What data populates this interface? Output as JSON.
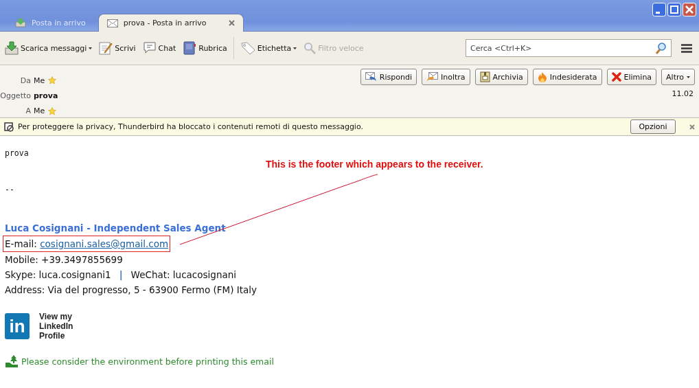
{
  "window": {
    "tabs": [
      {
        "label": "Posta in arrivo",
        "kind": "inbox",
        "selected": false,
        "closable": false
      },
      {
        "label": "prova - Posta in arrivo",
        "kind": "envelope",
        "selected": true,
        "closable": true
      }
    ]
  },
  "toolbar": {
    "groups": [
      [
        {
          "label": "Scarica messaggi",
          "kind": "download",
          "dropdown": true,
          "disabled": false
        },
        {
          "label": "Scrivi",
          "kind": "write",
          "dropdown": false,
          "disabled": false
        },
        {
          "label": "Chat",
          "kind": "chat",
          "dropdown": false,
          "disabled": false
        },
        {
          "label": "Rubrica",
          "kind": "book",
          "dropdown": false,
          "disabled": false
        }
      ],
      [
        {
          "label": "Etichetta",
          "kind": "tag",
          "dropdown": true,
          "disabled": false
        },
        {
          "label": "Filtro veloce",
          "kind": "magnifier",
          "dropdown": false,
          "disabled": true
        }
      ]
    ],
    "search": {
      "placeholder": "Cerca <Ctrl+K>"
    }
  },
  "header": {
    "fields": [
      {
        "label": "Da",
        "value": "Me",
        "kind": "contact",
        "starred": true
      },
      {
        "label": "Oggetto",
        "value": "prova",
        "kind": "subject"
      },
      {
        "label": "A",
        "value": "Me",
        "kind": "contact",
        "starred": true
      }
    ],
    "actions": [
      {
        "label": "Rispondi",
        "kind": "reply",
        "dropdown": false
      },
      {
        "label": "Inoltra",
        "kind": "forward",
        "dropdown": false
      },
      {
        "label": "Archivia",
        "kind": "archive",
        "dropdown": false
      },
      {
        "label": "Indesiderata",
        "kind": "flame",
        "dropdown": false
      },
      {
        "label": "Elimina",
        "kind": "delete",
        "dropdown": false
      },
      {
        "label": "Altro",
        "kind": "menu",
        "dropdown": true
      }
    ],
    "time": "11.02"
  },
  "notification": {
    "text": "Per proteggere la privacy, Thunderbird ha bloccato i contenuti remoti di questo messaggio.",
    "button": "Opzioni"
  },
  "body": {
    "greeting": "prova",
    "separator": "--",
    "signature": {
      "name": "Luca Cosignani - Independent Sales Agent",
      "email": {
        "label": "E-mail: ",
        "link": "cosignani.sales@gmail.com",
        "highlighted": true
      },
      "mobile": "Mobile: +39.3497855699",
      "skype": "Skype: luca.cosignani1",
      "divider": "|",
      "wechat": "WeChat: lucacosignani",
      "address": "Address: Via del progresso, 5 - 63900 Fermo (FM) Italy",
      "linkedin": {
        "logo": "in",
        "caption": [
          "View my",
          "LinkedIn",
          "Profile"
        ]
      },
      "eco_note": "Please consider the environment before printing this email"
    }
  },
  "annotation": {
    "text": "This is the footer which appears to the receiver."
  }
}
